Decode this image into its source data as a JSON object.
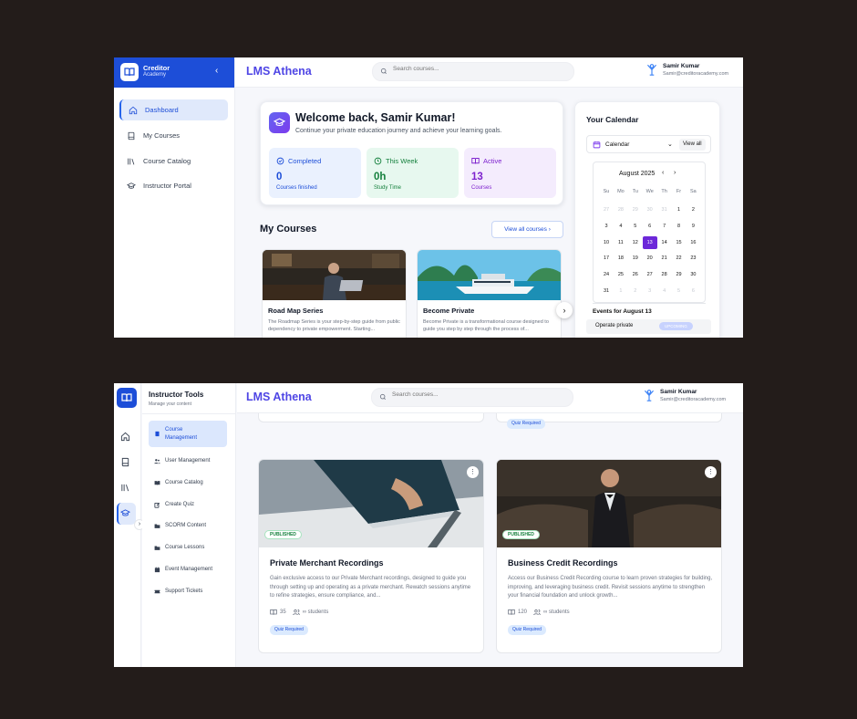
{
  "top": {
    "brand": {
      "name": "Creditor",
      "sub": "Academy"
    },
    "app_title": "LMS Athena",
    "search_placeholder": "Search courses...",
    "user": {
      "name": "Samir Kumar",
      "email": "Samir@creditoracademy.com"
    },
    "nav": [
      {
        "label": "Dashboard",
        "icon": "home-icon",
        "active": true
      },
      {
        "label": "My Courses",
        "icon": "book-icon"
      },
      {
        "label": "Course Catalog",
        "icon": "library-icon"
      },
      {
        "label": "Instructor Portal",
        "icon": "graduation-cap-icon"
      }
    ],
    "welcome": {
      "title": "Welcome back, Samir Kumar!",
      "subtitle": "Continue your private education journey and achieve your learning goals.",
      "stats": [
        {
          "label": "Completed",
          "value": "0",
          "note": "Courses finished",
          "color": "#1d4ed8"
        },
        {
          "label": "This Week",
          "value": "0h",
          "note": "Study Time",
          "color": "#15803d"
        },
        {
          "label": "Active",
          "value": "13",
          "note": "Courses",
          "color": "#7e22ce"
        }
      ]
    },
    "my_courses": {
      "heading": "My Courses",
      "view_all": "View all courses",
      "cards": [
        {
          "title": "Road Map Series",
          "desc": "The Roadmap Series is your step-by-step guide from public dependency to private empowerment. Starting..."
        },
        {
          "title": "Become Private",
          "desc": "Become Private is a transformational course designed to guide you step by step through the process of..."
        }
      ]
    },
    "calendar": {
      "title": "Your Calendar",
      "selector": "Calendar",
      "view_all": "View all",
      "month": "August 2025",
      "weekdays": [
        "Su",
        "Mo",
        "Tu",
        "We",
        "Th",
        "Fr",
        "Sa"
      ],
      "weeks": [
        [
          "27",
          "28",
          "29",
          "30",
          "31",
          "1",
          "2"
        ],
        [
          "3",
          "4",
          "5",
          "6",
          "7",
          "8",
          "9"
        ],
        [
          "10",
          "11",
          "12",
          "13",
          "14",
          "15",
          "16"
        ],
        [
          "17",
          "18",
          "19",
          "20",
          "21",
          "22",
          "23"
        ],
        [
          "24",
          "25",
          "26",
          "27",
          "28",
          "29",
          "30"
        ],
        [
          "31",
          "1",
          "2",
          "3",
          "4",
          "5",
          "6"
        ]
      ],
      "selected_day": "13",
      "events_title": "Events for August 13",
      "events": [
        {
          "name": "Operate private",
          "status": "UPCOMING"
        }
      ]
    }
  },
  "bottom": {
    "app_title": "LMS Athena",
    "search_placeholder": "Search courses...",
    "user": {
      "name": "Samir Kumar",
      "email": "Samir@creditoracademy.com"
    },
    "panel": {
      "title": "Instructor Tools",
      "subtitle": "Manage your content"
    },
    "nav": [
      {
        "label": "Course Management",
        "icon": "book-icon",
        "active": true
      },
      {
        "label": "User Management",
        "icon": "users-icon"
      },
      {
        "label": "Course Catalog",
        "icon": "open-book-icon"
      },
      {
        "label": "Create Quiz",
        "icon": "edit-icon"
      },
      {
        "label": "SCORM Content",
        "icon": "folder-icon"
      },
      {
        "label": "Course Lessons",
        "icon": "folder-icon"
      },
      {
        "label": "Event Management",
        "icon": "calendar-icon"
      },
      {
        "label": "Support Tickets",
        "icon": "ticket-icon"
      }
    ],
    "top_stub_badge": "Quiz Required",
    "cards": [
      {
        "title": "Private Merchant Recordings",
        "status": "PUBLISHED",
        "desc": "Gain exclusive access to our Private Merchant recordings, designed to guide you through setting up and operating as a private merchant. Rewatch sessions anytime to refine strategies, ensure compliance, and...",
        "lessons": "35",
        "students": "∞ students",
        "badge": "Quiz Required"
      },
      {
        "title": "Business Credit Recordings",
        "status": "PUBLISHED",
        "desc": "Access our Business Credit Recording course to learn proven strategies for building, improving, and leveraging business credit. Revisit sessions anytime to strengthen your financial foundation and unlock growth...",
        "lessons": "120",
        "students": "∞ students",
        "badge": "Quiz Required"
      }
    ]
  }
}
